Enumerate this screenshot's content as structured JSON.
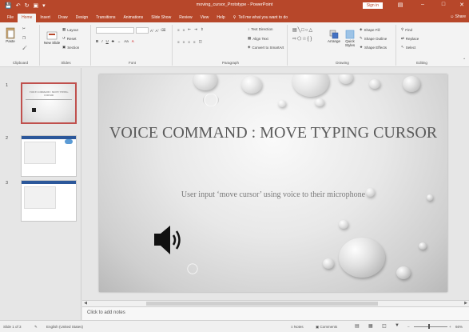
{
  "window": {
    "title": "moving_cursor_Prototype - PowerPoint",
    "signin_label": "Sign in"
  },
  "tabs": [
    {
      "label": "File"
    },
    {
      "label": "Home",
      "active": true
    },
    {
      "label": "Insert"
    },
    {
      "label": "Draw"
    },
    {
      "label": "Design"
    },
    {
      "label": "Transitions"
    },
    {
      "label": "Animations"
    },
    {
      "label": "Slide Show"
    },
    {
      "label": "Review"
    },
    {
      "label": "View"
    },
    {
      "label": "Help"
    }
  ],
  "tell_me": "Tell me what you want to do",
  "share_label": "Share",
  "ribbon": {
    "clipboard": {
      "label": "Clipboard",
      "paste": "Paste"
    },
    "slides": {
      "label": "Slides",
      "new_slide": "New Slide",
      "layout": "Layout",
      "reset": "Reset",
      "section": "Section"
    },
    "font": {
      "label": "Font"
    },
    "paragraph": {
      "label": "Paragraph",
      "text_direction": "Text Direction",
      "align_text": "Align Text",
      "convert_smartart": "Convert to SmartArt"
    },
    "drawing": {
      "label": "Drawing",
      "arrange": "Arrange",
      "quick_styles": "Quick Styles",
      "shape_fill": "Shape Fill",
      "shape_outline": "Shape Outline",
      "shape_effects": "Shape Effects"
    },
    "editing": {
      "label": "Editing",
      "find": "Find",
      "replace": "Replace",
      "select": "Select"
    }
  },
  "thumbnails": [
    {
      "number": "1",
      "title": "VOICE COMMAND : MOVE TYPING CURSOR"
    },
    {
      "number": "2"
    },
    {
      "number": "3"
    }
  ],
  "slide": {
    "title": "VOICE COMMAND : MOVE TYPING CURSOR",
    "subtitle": "User input ‘move cursor’ using voice to their microphone"
  },
  "notes_placeholder": "Click to add notes",
  "status": {
    "slide_count": "Slide 1 of 3",
    "language": "English (United States)",
    "notes": "Notes",
    "comments": "Comments",
    "zoom": "66%"
  }
}
